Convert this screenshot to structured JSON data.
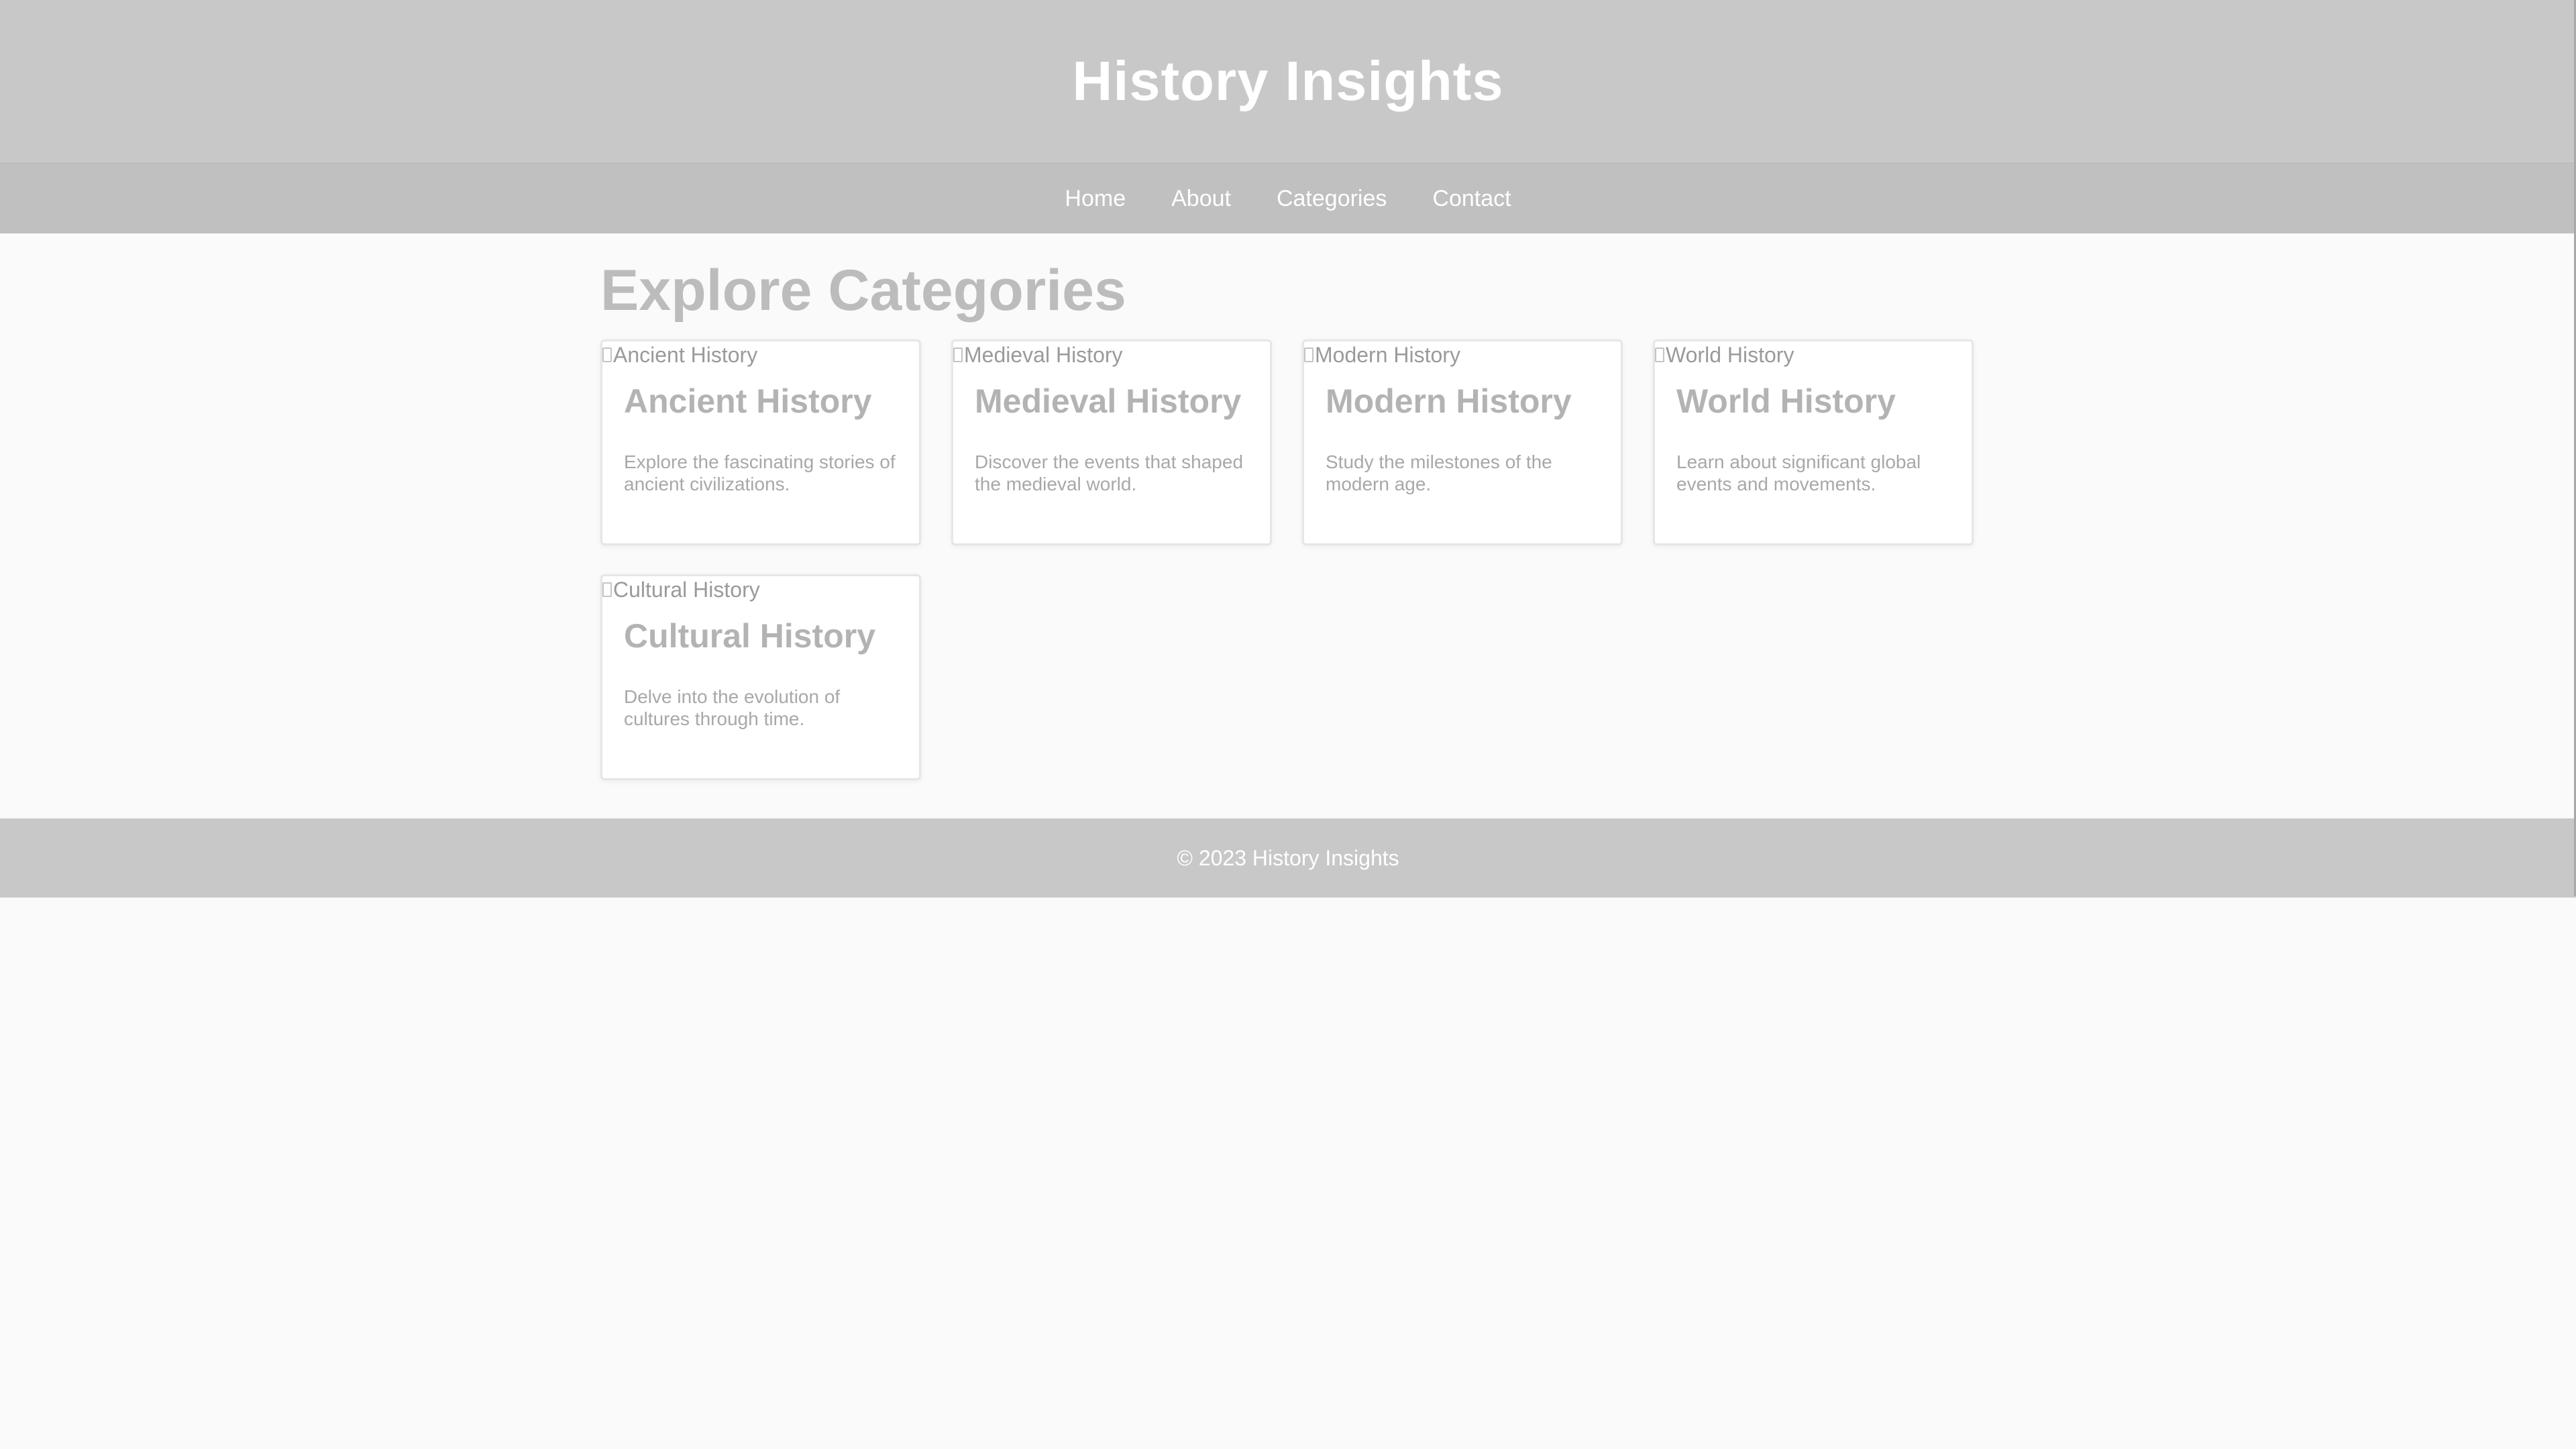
{
  "header": {
    "title": "History Insights"
  },
  "nav": {
    "items": [
      {
        "label": "Home"
      },
      {
        "label": "About"
      },
      {
        "label": "Categories"
      },
      {
        "label": "Contact"
      }
    ]
  },
  "main": {
    "section_title": "Explore Categories",
    "cards": [
      {
        "image_alt": "Ancient History",
        "title": "Ancient History",
        "description": "Explore the fascinating stories of ancient civilizations."
      },
      {
        "image_alt": "Medieval History",
        "title": "Medieval History",
        "description": "Discover the events that shaped the medieval world."
      },
      {
        "image_alt": "Modern History",
        "title": "Modern History",
        "description": "Study the milestones of the modern age."
      },
      {
        "image_alt": "World History",
        "title": "World History",
        "description": "Learn about significant global events and movements."
      },
      {
        "image_alt": "Cultural History",
        "title": "Cultural History",
        "description": "Delve into the evolution of cultures through time."
      }
    ]
  },
  "footer": {
    "text": "© 2023 History Insights"
  },
  "colors": {
    "header_bg": "#c8c8c8",
    "nav_bg": "#c0c0c0",
    "page_bg": "#fafafa",
    "card_bg": "#ffffff",
    "accent_text": "#ffffff"
  }
}
